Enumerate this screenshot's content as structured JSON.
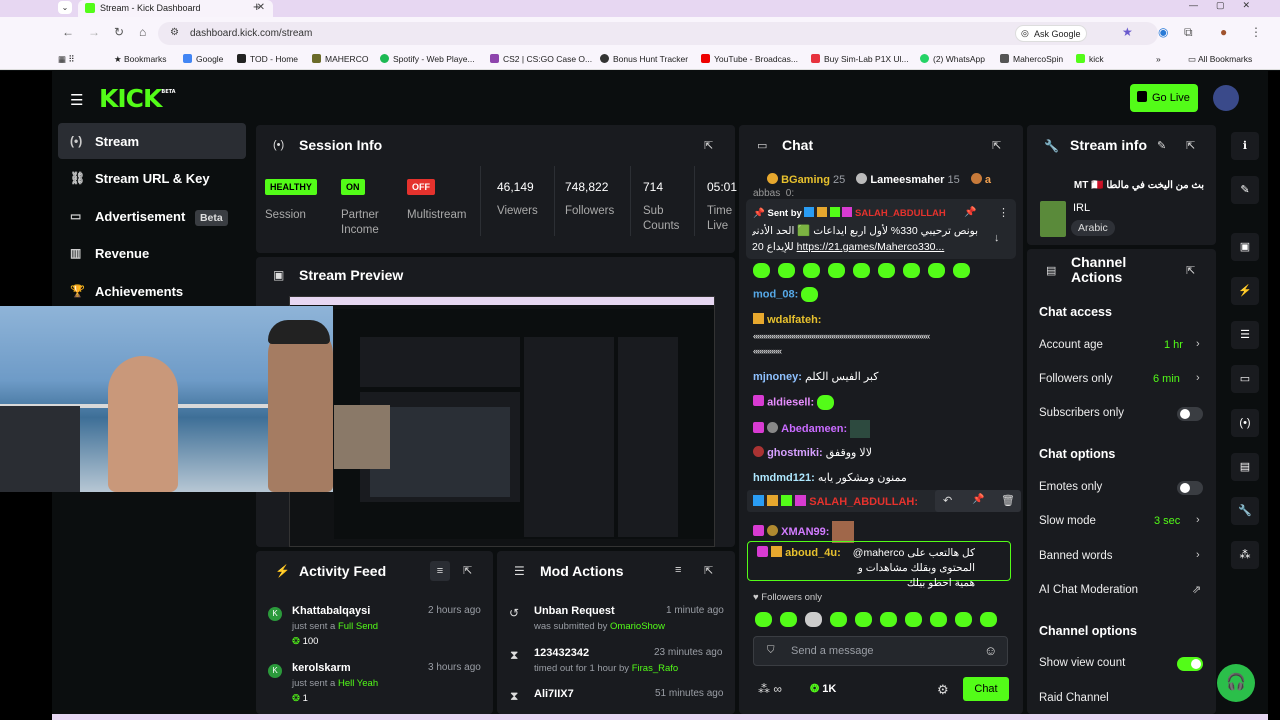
{
  "browser": {
    "tab_title": "Stream - Kick Dashboard",
    "url": "dashboard.kick.com/stream",
    "ask_google": "Ask Google",
    "bookmarks": [
      "Bookmarks",
      "Google",
      "TOD - Home",
      "MAHERCO",
      "Spotify - Web Playe...",
      "CS2 | CS:GO Case O...",
      "Bonus Hunt Tracker",
      "YouTube - Broadcas...",
      "Buy Sim-Lab P1X Ul...",
      "(2) WhatsApp",
      "MahercoSpin",
      "kick"
    ],
    "all_bookmarks": "All Bookmarks"
  },
  "header": {
    "logo": "KICK",
    "logo_sup": "BETA",
    "go_live": "Go Live"
  },
  "sidebar": {
    "items": [
      {
        "label": "Stream"
      },
      {
        "label": "Stream URL & Key"
      },
      {
        "label": "Advertisement",
        "badge": "Beta"
      },
      {
        "label": "Revenue"
      },
      {
        "label": "Achievements"
      }
    ]
  },
  "session_info": {
    "title": "Session Info",
    "stats": [
      {
        "badge": "HEALTHY",
        "label": "Session"
      },
      {
        "badge": "ON",
        "label": "Partner Income"
      },
      {
        "badge": "OFF",
        "label": "Multistream"
      },
      {
        "value": "46,149",
        "label": "Viewers"
      },
      {
        "value": "748,822",
        "label": "Followers"
      },
      {
        "value": "714",
        "label": "Sub Counts"
      },
      {
        "value": "05:01",
        "label": "Time Live"
      }
    ]
  },
  "stream_preview": {
    "title": "Stream Preview"
  },
  "activity_feed": {
    "title": "Activity Feed",
    "items": [
      {
        "user": "Khattabalqaysi",
        "time": "2 hours ago",
        "action": "just sent a",
        "item": "Full Send",
        "amount": "100"
      },
      {
        "user": "kerolskarm",
        "time": "3 hours ago",
        "action": "just sent a",
        "item": "Hell Yeah",
        "amount": "1"
      }
    ]
  },
  "mod_actions": {
    "title": "Mod Actions",
    "items": [
      {
        "title": "Unban Request",
        "time": "1 minute ago",
        "sub": "was submitted by",
        "user": "OmarioShow"
      },
      {
        "title": "123432342",
        "time": "23 minutes ago",
        "sub": "timed out for 1 hour by",
        "user": "Firas_Rafo"
      },
      {
        "title": "Ali7IIX7",
        "time": "51 minutes ago",
        "sub": "",
        "user": ""
      }
    ]
  },
  "chat": {
    "title": "Chat",
    "top_gifters": [
      {
        "name": "BGaming",
        "count": "25"
      },
      {
        "name": "Lameesmaher",
        "count": "15"
      },
      {
        "name": "a",
        "count": ""
      }
    ],
    "partial_name": "abbas_0:",
    "pinned": {
      "sent_by": "Sent by",
      "user": "SALAH_ABDULLAH",
      "text1": "بونص ترحيبي 330% لأول اربع ايداعات 🟩 الحد الأدنى",
      "text2": "للإيداع 20",
      "link": "https://21.games/Maherco330..."
    },
    "messages": [
      {
        "user": "mod_08:",
        "text": ""
      },
      {
        "user": "wdalfateh:",
        "text": ""
      },
      {
        "user": "",
        "text": "««««««««««««««««««««««««««««««««««««««««««««"
      },
      {
        "user": "",
        "text": "«««««««"
      },
      {
        "user": "mjnoney:",
        "text": "كبر الفيس الكلم"
      },
      {
        "user": "aldiesell:",
        "text": ""
      },
      {
        "user": "Abedameen:",
        "text": ""
      },
      {
        "user": "ghostmiki:",
        "text": "لالا ووقفق"
      },
      {
        "user": "hmdmd121:",
        "text": "ممنون ومشكور يابه"
      },
      {
        "user": "SALAH_ABDULLAH:",
        "text": ""
      },
      {
        "user": "XMAN99:",
        "text": ""
      },
      {
        "user": "aboud_4u:",
        "text": "@maherco كل هالتعب على المحتوى وبقلك مشاهدات و همية احطو بيلك"
      }
    ],
    "followers_only": "Followers only",
    "placeholder": "Send a message",
    "viewers": "1K",
    "chat_button": "Chat"
  },
  "stream_info": {
    "title": "Stream info",
    "stream_title": "بث من اليخت في مالطا MT 🇲🇹",
    "category": "IRL",
    "language": "Arabic"
  },
  "channel_actions": {
    "title": "Channel Actions",
    "sections": [
      {
        "heading": "Chat access",
        "rows": [
          {
            "label": "Account age",
            "value": "1 hr",
            "kind": "chevron"
          },
          {
            "label": "Followers only",
            "value": "6 min",
            "kind": "chevron"
          },
          {
            "label": "Subscribers only",
            "kind": "toggle-off"
          }
        ]
      },
      {
        "heading": "Chat options",
        "rows": [
          {
            "label": "Emotes only",
            "kind": "toggle-off"
          },
          {
            "label": "Slow mode",
            "value": "3 sec",
            "kind": "chevron"
          },
          {
            "label": "Banned words",
            "kind": "chevron"
          },
          {
            "label": "AI Chat Moderation",
            "kind": "external"
          }
        ]
      },
      {
        "heading": "Channel options",
        "rows": [
          {
            "label": "Show view count",
            "kind": "toggle-on"
          },
          {
            "label": "Raid Channel",
            "kind": "none"
          }
        ]
      }
    ]
  },
  "colors": {
    "brand": "#53fc18",
    "panel": "#191b1f",
    "bg": "#0b0e0f",
    "danger": "#e5322d"
  }
}
